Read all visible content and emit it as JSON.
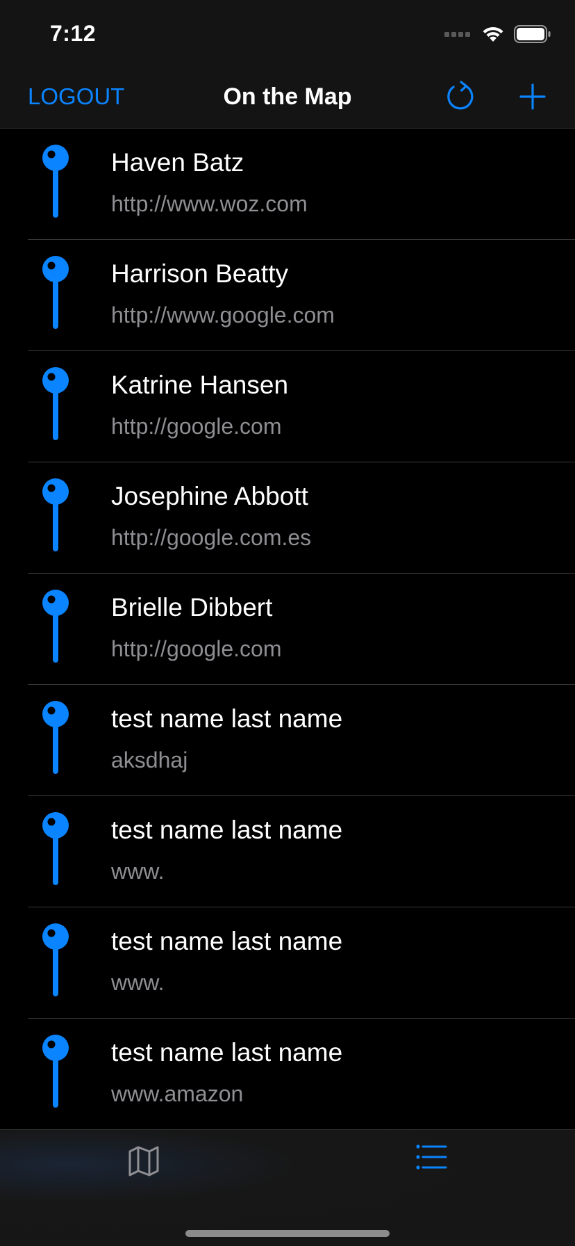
{
  "status_bar": {
    "time": "7:12"
  },
  "nav": {
    "logout_label": "LOGOUT",
    "title": "On the Map",
    "refresh_icon": "refresh-icon",
    "add_icon": "plus-icon"
  },
  "list": {
    "items": [
      {
        "name": "Haven Batz",
        "url": "http://www.woz.com"
      },
      {
        "name": "Harrison Beatty",
        "url": "http://www.google.com"
      },
      {
        "name": "Katrine Hansen",
        "url": "http://google.com"
      },
      {
        "name": "Josephine Abbott",
        "url": "http://google.com.es"
      },
      {
        "name": "Brielle Dibbert",
        "url": "http://google.com"
      },
      {
        "name": "test name last name",
        "url": "aksdhaj"
      },
      {
        "name": "test name last name",
        "url": "www."
      },
      {
        "name": "test name last name",
        "url": "www."
      },
      {
        "name": "test name last name",
        "url": "www.amazon"
      }
    ]
  },
  "tab_bar": {
    "tabs": [
      {
        "icon": "map-icon",
        "selected": false
      },
      {
        "icon": "list-icon",
        "selected": true
      }
    ]
  },
  "colors": {
    "accent": "#0a84ff",
    "background": "#000000",
    "bar_background": "#141414",
    "subtitle": "#8e8e93",
    "inactive_tab": "#8e8e93"
  }
}
